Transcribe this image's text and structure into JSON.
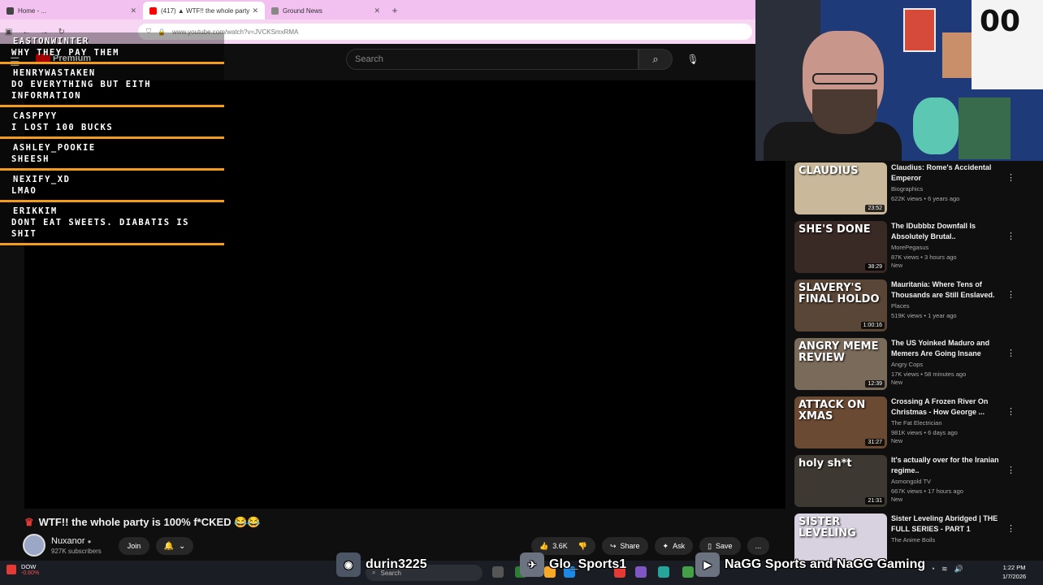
{
  "browser": {
    "tabs": [
      {
        "label": "Home - ...",
        "active": false
      },
      {
        "label": "(417) ▲ WTF!! the whole party",
        "active": true
      },
      {
        "label": "Ground News",
        "active": false
      }
    ],
    "new_tab": "+",
    "url": "www.youtube.com/watch?v=JVCKSmxRMA"
  },
  "youtube": {
    "logo": "Premium",
    "search_placeholder": "Search"
  },
  "chat": [
    {
      "user": "EASTONWINTER",
      "text": "WHY THEY PAY THEM"
    },
    {
      "user": "HENRYWASTAKEN",
      "text": "DO EVERYTHING BUT EITH INFORMATION"
    },
    {
      "user": "CASPPYY",
      "text": "I LOST 100 BUCKS"
    },
    {
      "user": "ASHLEY_POOKIE",
      "text": "SHEESH"
    },
    {
      "user": "NEXIFY_XD",
      "text": "LMAO"
    },
    {
      "user": "ERIKKIM",
      "text": "DONT EAT SWEETS. DIABATIS IS SHIT"
    }
  ],
  "video": {
    "title": "WTF!! the whole party is 100% f*CKED 😂😂",
    "channel": "Nuxanor",
    "subscribers": "927K subscribers",
    "join": "Join",
    "likes": "3.6K",
    "share": "Share",
    "ask": "Ask",
    "save": "Save",
    "more": "..."
  },
  "recommendations": [
    {
      "title": "Claudius: Rome's Accidental Emperor",
      "channel": "Biographics",
      "meta": "622K views • 6 years ago",
      "badge": "",
      "duration": "23:52",
      "thumb_text": "CLAUDIUS",
      "thumb_color": "#c9b99a"
    },
    {
      "title": "The IDubbbz Downfall Is Absolutely Brutal..",
      "channel": "MorePegasus",
      "meta": "87K views • 3 hours ago",
      "badge": "New",
      "duration": "38:29",
      "thumb_text": "SHE'S DONE",
      "thumb_color": "#3a2a26"
    },
    {
      "title": "Mauritania: Where Tens of Thousands are Still Enslaved.",
      "channel": "Places",
      "meta": "519K views • 1 year ago",
      "badge": "",
      "duration": "1:00:16",
      "thumb_text": "SLAVERY'S FINAL HOLDO",
      "thumb_color": "#5a4636"
    },
    {
      "title": "The US Yoinked Maduro and Memers Are Going Insane",
      "channel": "Angry Cops",
      "meta": "17K views • 58 minutes ago",
      "badge": "New",
      "duration": "12:39",
      "thumb_text": "ANGRY MEME REVIEW",
      "thumb_color": "#7a6a5a"
    },
    {
      "title": "Crossing A Frozen River On Christmas - How George ...",
      "channel": "The Fat Electrician",
      "meta": "981K views • 6 days ago",
      "badge": "New",
      "duration": "31:27",
      "thumb_text": "ATTACK ON XMAS",
      "thumb_color": "#6b4a33"
    },
    {
      "title": "It's actually over for the Iranian regime..",
      "channel": "Asmongold TV",
      "meta": "667K views • 17 hours ago",
      "badge": "New",
      "duration": "21:31",
      "thumb_text": "holy sh*t",
      "thumb_color": "#3d3832"
    },
    {
      "title": "Sister Leveling Abridged | THE FULL SERIES - PART 1",
      "channel": "The Anime Boils",
      "meta": "",
      "badge": "",
      "duration": "",
      "thumb_text": "SISTER LEVELING",
      "thumb_color": "#d8d2e0"
    }
  ],
  "overlay": {
    "discord": "durin3225",
    "twitter": "Glo_Sports1",
    "youtube": "NaGG Sports and NaGG Gaming"
  },
  "taskbar": {
    "stock_name": "DOW",
    "stock_change": "-0.60%",
    "search": "Search",
    "time": "1:22 PM",
    "date": "1/7/2026"
  }
}
